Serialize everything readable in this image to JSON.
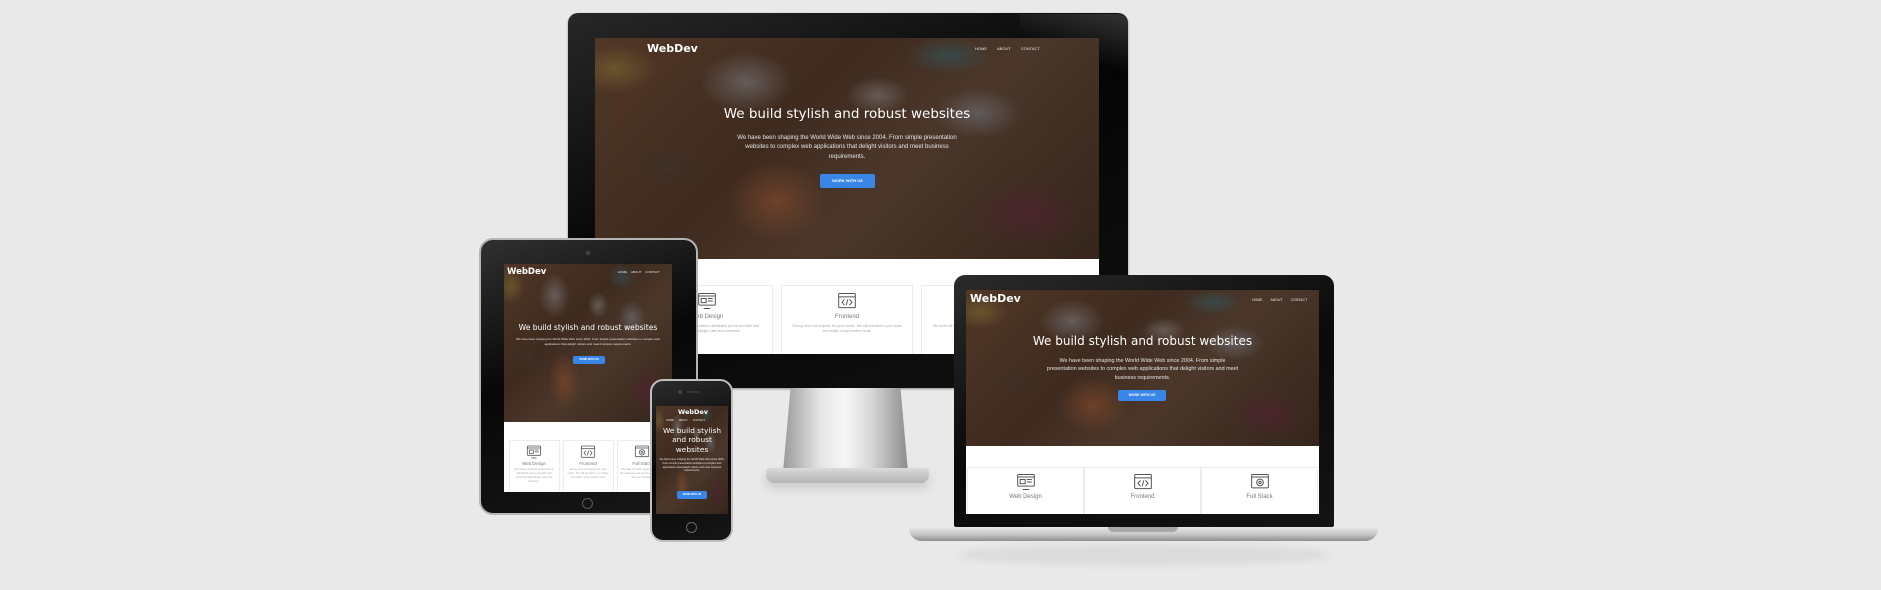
{
  "site": {
    "brand": "WebDev",
    "nav": [
      "HOME",
      "ABOUT",
      "CONTACT"
    ],
    "headline": "We build stylish and robust websites",
    "lead": "We have been shaping the World Wide Web since 2004. From simple presentation websites to complex web applications that delight visitors and meet business requirements.",
    "cta_label": "WORK WITH US",
    "services": [
      {
        "title": "Web Design",
        "icon": "web-design-icon",
        "text": "We create professional websites in affordable prices and with well structured web design rules and elements."
      },
      {
        "title": "Frontend",
        "icon": "code-window-icon",
        "text": "Strong front end experts for your needs. We will transform your ideas into reality using modern tools."
      },
      {
        "title": "Full Stack",
        "icon": "full-stack-icon",
        "text": "We build full stack applications, from the database and server all the way to the user interface."
      }
    ]
  },
  "colors": {
    "background": "#e9e9e9",
    "accent": "#3a86e8",
    "device_body": "#0b0b0b",
    "card_border": "#ececec"
  },
  "devices": [
    "desktop-monitor",
    "laptop",
    "tablet",
    "smartphone"
  ]
}
